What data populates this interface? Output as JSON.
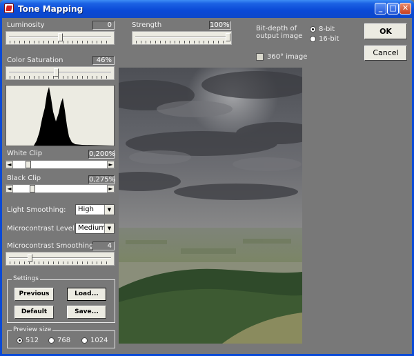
{
  "window": {
    "title": "Tone Mapping",
    "minimize_glyph": "_",
    "maximize_glyph": "□",
    "close_glyph": "✕"
  },
  "luminosity": {
    "label": "Luminosity",
    "value": "0",
    "level": 0.5
  },
  "strength": {
    "label": "Strength",
    "value": "100%",
    "level": 1.0
  },
  "color_saturation": {
    "label": "Color Saturation",
    "value": "46%",
    "level": 0.46
  },
  "white_clip": {
    "label": "White Clip",
    "value": "0,200%"
  },
  "black_clip": {
    "label": "Black Clip",
    "value": "0,275%"
  },
  "light_smoothing": {
    "label": "Light Smoothing:",
    "value": "High"
  },
  "microcontrast_level": {
    "label": "Microcontrast Level:",
    "value": "Medium"
  },
  "microcontrast_smoothing": {
    "label": "Microcontrast Smoothing",
    "value": "4",
    "level": 0.2
  },
  "settings": {
    "title": "Settings",
    "previous": "Previous",
    "load": "Load...",
    "default": "Default",
    "save": "Save..."
  },
  "preview_size": {
    "title": "Preview size",
    "options": [
      "512",
      "768",
      "1024"
    ],
    "selected": "512"
  },
  "bit_depth": {
    "label_line1": "Bit-depth of",
    "label_line2": "output image",
    "options": [
      "8-bit",
      "16-bit"
    ],
    "selected": "8-bit"
  },
  "image_360": {
    "label": "360° image",
    "checked": false
  },
  "buttons": {
    "ok": "OK",
    "cancel": "Cancel"
  },
  "icons": {
    "scroll_left": "◄",
    "scroll_right": "►",
    "dropdown": "▼"
  },
  "colors": {
    "background": "#787878",
    "titlebar": "#0a49d6",
    "control_face": "#ecebe2"
  }
}
